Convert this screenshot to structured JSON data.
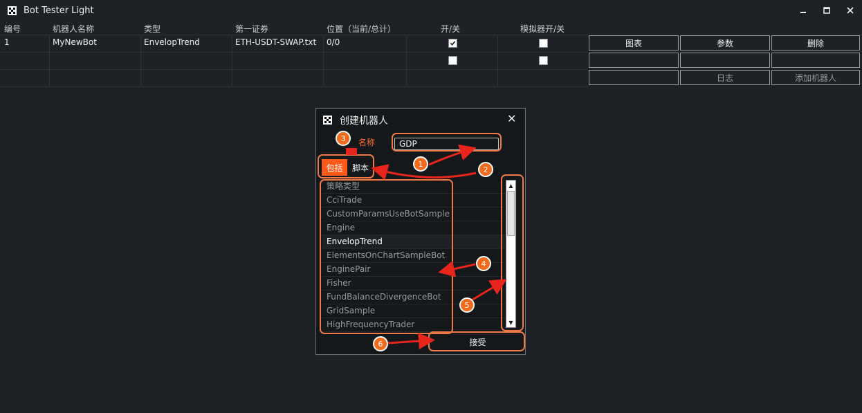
{
  "app": {
    "title": "Bot Tester Light"
  },
  "window_controls": {
    "minimize": "–",
    "maximize": "□",
    "close": "✕"
  },
  "table": {
    "headers": [
      "编号",
      "机器人名称",
      "类型",
      "第一证券",
      "位置（当前/总计）",
      "开/关",
      "模拟器开/关"
    ],
    "rows": [
      {
        "num": "1",
        "name": "MyNewBot",
        "type": "EnvelopTrend",
        "security": "ETH-USDT-SWAP.txt",
        "position": "0/0",
        "on": true,
        "emulator": false
      },
      {
        "num": "",
        "name": "",
        "type": "",
        "security": "",
        "position": "",
        "on": false,
        "emulator": false
      }
    ]
  },
  "buttons": {
    "chart": "图表",
    "params": "参数",
    "delete": "删除",
    "log": "日志",
    "add_bot": "添加机器人"
  },
  "dialog": {
    "title": "创建机器人",
    "close": "✕",
    "name_label": "名称",
    "name_value": "GDP",
    "tab_include": "包括",
    "tab_script": "脚本",
    "list_header": "策略类型",
    "strategies": [
      "CciTrade",
      "CustomParamsUseBotSample",
      "Engine",
      "EnvelopTrend",
      "ElementsOnChartSampleBot",
      "EnginePair",
      "Fisher",
      "FundBalanceDivergenceBot",
      "GridSample",
      "HighFrequencyTrader"
    ],
    "selected": "EnvelopTrend",
    "accept": "接受"
  },
  "annotations": [
    "1",
    "2",
    "3",
    "4",
    "5",
    "6"
  ],
  "colors": {
    "accent": "#ff5a1a",
    "bg": "#1e2226",
    "dialog_bg": "#15181b",
    "annotation_red": "#e8251c"
  }
}
